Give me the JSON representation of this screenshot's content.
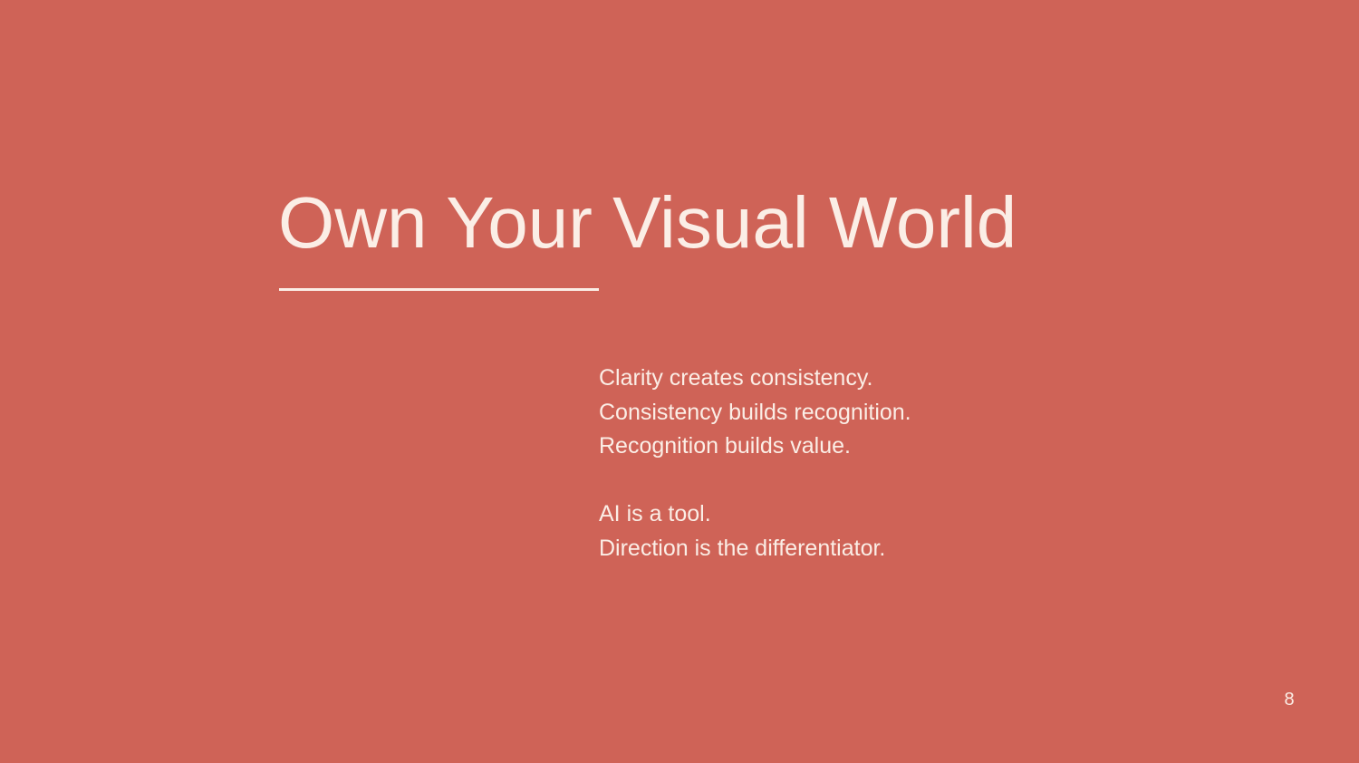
{
  "slide": {
    "title": "Own Your Visual World",
    "body_lines_group1": [
      "Clarity creates consistency.",
      "Consistency builds recognition.",
      "Recognition builds value."
    ],
    "body_lines_group2": [
      "AI is a tool.",
      "Direction is the differentiator."
    ],
    "page_number": "8"
  },
  "colors": {
    "background": "#cf6357",
    "text": "#fbeee6"
  }
}
